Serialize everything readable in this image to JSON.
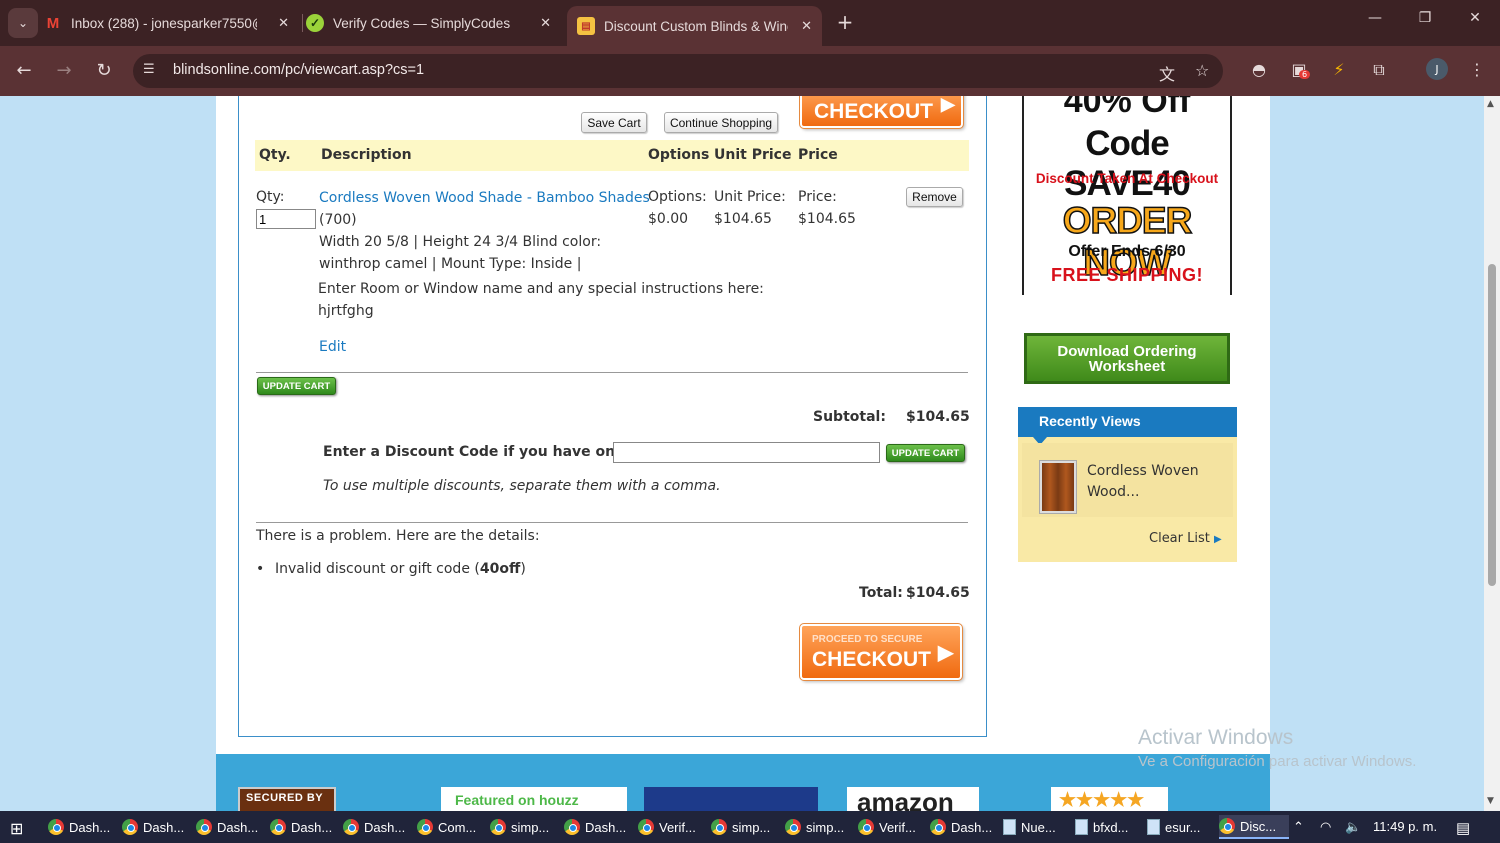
{
  "browser": {
    "tabs": [
      {
        "label": "Inbox (288) - jonesparker7550@",
        "icon": "gmail-icon"
      },
      {
        "label": "Verify Codes — SimplyCodes",
        "icon": "simplycodes-icon"
      },
      {
        "label": "Discount Custom Blinds & Winc",
        "icon": "blindsonline-icon",
        "active": true
      }
    ],
    "url": "blindsonline.com/pc/viewcart.asp?cs=1",
    "avatar_letter": "J",
    "ext_badge": "6"
  },
  "cart": {
    "save_cart": "Save Cart",
    "continue_shopping": "Continue Shopping",
    "checkout_top": "CHECKOUT",
    "headers": {
      "qty": "Qty.",
      "description": "Description",
      "options": "Options",
      "unit_price": "Unit Price",
      "price": "Price"
    },
    "item": {
      "qty_label": "Qty:",
      "qty_value": "1",
      "name": "Cordless Woven Wood Shade - Bamboo Shades",
      "code": "(700)",
      "specs_line1": "Width 20 5/8 | Height 24 3/4 Blind color:",
      "specs_line2": "winthrop camel | Mount Type: Inside |",
      "instructions_label": "Enter Room or Window name and any special instructions here:",
      "instructions_value": "hjrtfghg",
      "edit": "Edit",
      "options_label": "Options:",
      "options_value": "$0.00",
      "unit_price_label": "Unit Price:",
      "unit_price_value": "$104.65",
      "price_label": "Price:",
      "price_value": "$104.65",
      "remove": "Remove"
    },
    "update_cart": "UPDATE CART",
    "subtotal_label": "Subtotal:",
    "subtotal_value": "$104.65",
    "discount_label": "Enter a Discount Code if you have one:",
    "discount_note": "To use multiple discounts, separate them with a comma.",
    "problem_text": "There is a problem. Here are the details:",
    "error_prefix": "Invalid discount or gift code (",
    "error_code": "40off",
    "error_suffix": ")",
    "total_label": "Total:",
    "total_value": "$104.65",
    "checkout_bottom_small": "PROCEED TO SECURE",
    "checkout_bottom": "CHECKOUT"
  },
  "sidebar": {
    "ad": {
      "top_partial": "40% Off",
      "code": "Code SAVE40",
      "discount_note": "Discount Taken At Checkout",
      "order_now": "ORDER NOW",
      "offer_ends": "Offer Ends 6/30",
      "free_shipping": "FREE SHIPPING!"
    },
    "download_button": "Download Ordering Worksheet",
    "recently": {
      "title": "Recently Views",
      "item": "Cordless Woven Wood...",
      "clear": "Clear List"
    }
  },
  "footer_badges": {
    "secured": "SECURED BY",
    "houzz": "Featured on houzz",
    "amazon": "amazon",
    "stars": "★★★★★"
  },
  "watermark": {
    "line1": "Activar Windows",
    "line2": "Ve a Configuración para activar Windows."
  },
  "taskbar": {
    "items": [
      "Dash...",
      "Dash...",
      "Dash...",
      "Dash...",
      "Dash...",
      "Com...",
      "simp...",
      "Dash...",
      "Verif...",
      "simp...",
      "simp...",
      "Verif...",
      "Dash...",
      "Nue...",
      "bfxd...",
      "esur...",
      "Disc..."
    ],
    "time": "11:49 p. m."
  }
}
